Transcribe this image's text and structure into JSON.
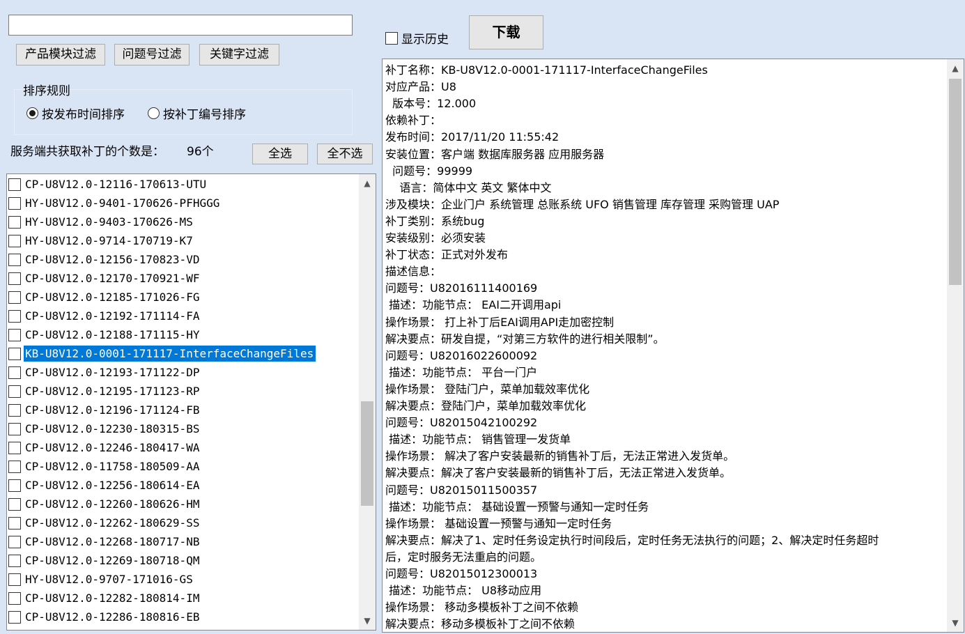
{
  "filter": {
    "value": "",
    "placeholder": ""
  },
  "buttons": {
    "product_filter": "产品模块过滤",
    "issue_filter": "问题号过滤",
    "keyword_filter": "关键字过滤",
    "select_all": "全选",
    "select_none": "全不选",
    "download": "下载"
  },
  "sort": {
    "title": "排序规则",
    "by_time": "按发布时间排序",
    "by_number": "按补丁编号排序",
    "selected": "by_time"
  },
  "count_label": "服务端共获取补丁的个数是：",
  "count_value": "96个",
  "show_history": {
    "label": "显示历史",
    "checked": false
  },
  "patches": [
    {
      "name": "CP-U8V12.0-12116-170613-UTU",
      "checked": false,
      "selected": false
    },
    {
      "name": "HY-U8V12.0-9401-170626-PFHGGG",
      "checked": false,
      "selected": false
    },
    {
      "name": "HY-U8V12.0-9403-170626-MS",
      "checked": false,
      "selected": false
    },
    {
      "name": "HY-U8V12.0-9714-170719-K7",
      "checked": false,
      "selected": false
    },
    {
      "name": "CP-U8V12.0-12156-170823-VD",
      "checked": false,
      "selected": false
    },
    {
      "name": "CP-U8V12.0-12170-170921-WF",
      "checked": false,
      "selected": false
    },
    {
      "name": "CP-U8V12.0-12185-171026-FG",
      "checked": false,
      "selected": false
    },
    {
      "name": "CP-U8V12.0-12192-171114-FA",
      "checked": false,
      "selected": false
    },
    {
      "name": "CP-U8V12.0-12188-171115-HY",
      "checked": false,
      "selected": false
    },
    {
      "name": "KB-U8V12.0-0001-171117-InterfaceChangeFiles",
      "checked": false,
      "selected": true
    },
    {
      "name": "CP-U8V12.0-12193-171122-DP",
      "checked": false,
      "selected": false
    },
    {
      "name": "CP-U8V12.0-12195-171123-RP",
      "checked": false,
      "selected": false
    },
    {
      "name": "CP-U8V12.0-12196-171124-FB",
      "checked": false,
      "selected": false
    },
    {
      "name": "CP-U8V12.0-12230-180315-BS",
      "checked": false,
      "selected": false
    },
    {
      "name": "CP-U8V12.0-12246-180417-WA",
      "checked": false,
      "selected": false
    },
    {
      "name": "CP-U8V12.0-11758-180509-AA",
      "checked": false,
      "selected": false
    },
    {
      "name": "CP-U8V12.0-12256-180614-EA",
      "checked": false,
      "selected": false
    },
    {
      "name": "CP-U8V12.0-12260-180626-HM",
      "checked": false,
      "selected": false
    },
    {
      "name": "CP-U8V12.0-12262-180629-SS",
      "checked": false,
      "selected": false
    },
    {
      "name": "CP-U8V12.0-12268-180717-NB",
      "checked": false,
      "selected": false
    },
    {
      "name": "CP-U8V12.0-12269-180718-QM",
      "checked": false,
      "selected": false
    },
    {
      "name": "HY-U8V12.0-9707-171016-GS",
      "checked": false,
      "selected": false
    },
    {
      "name": "CP-U8V12.0-12282-180814-IM",
      "checked": false,
      "selected": false
    },
    {
      "name": "CP-U8V12.0-12286-180816-EB",
      "checked": false,
      "selected": false
    }
  ],
  "detail_lines": [
    "补丁名称：KB-U8V12.0-0001-171117-InterfaceChangeFiles",
    "对应产品：U8",
    "  版本号：12.000",
    "依赖补丁：",
    "发布时间：2017/11/20 11:55:42",
    "安装位置：客户端 数据库服务器 应用服务器",
    "  问题号：99999",
    "    语言：简体中文 英文 繁体中文",
    "涉及模块：企业门户 系统管理 总账系统 UFO 销售管理 库存管理 采购管理 UAP",
    "补丁类别：系统bug",
    "安装级别：必须安装",
    "补丁状态：正式对外发布",
    "描述信息：",
    "问题号：U82016111400169",
    " 描述：功能节点： EAI二开调用api",
    "操作场景： 打上补丁后EAI调用API走加密控制",
    "解决要点：研发自提，“对第三方软件的进行相关限制”。",
    "问题号：U82016022600092",
    " 描述：功能节点： 平台一门户",
    "操作场景： 登陆门户，菜单加载效率优化",
    "解决要点：登陆门户，菜单加载效率优化",
    "问题号：U82015042100292",
    " 描述：功能节点： 销售管理一发货单",
    "操作场景： 解决了客户安装最新的销售补丁后，无法正常进入发货单。",
    "解决要点：解决了客户安装最新的销售补丁后，无法正常进入发货单。",
    "问题号：U82015011500357",
    " 描述：功能节点： 基础设置一预警与通知一定时任务",
    "操作场景： 基础设置一预警与通知一定时任务",
    "解决要点：解决了1、定时任务设定执行时间段后，定时任务无法执行的问题；2、解决定时任务超时",
    "后，定时服务无法重启的问题。",
    "问题号：U82015012300013",
    " 描述：功能节点： U8移动应用",
    "操作场景： 移动多模板补丁之间不依赖",
    "解决要点：移动多模板补丁之间不依赖"
  ]
}
